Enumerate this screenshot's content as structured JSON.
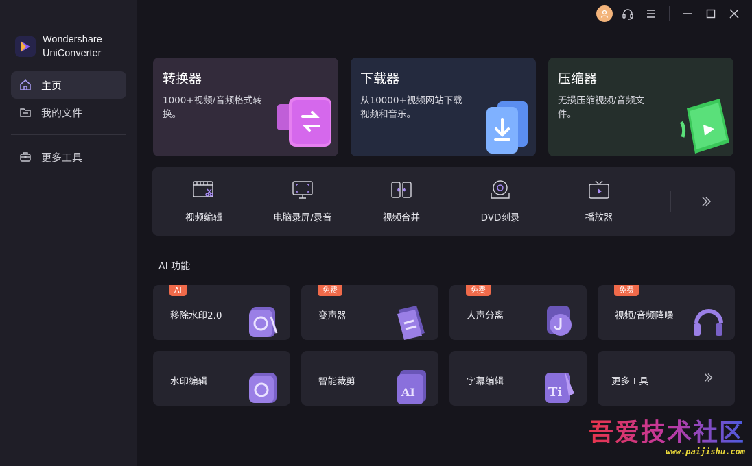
{
  "brand": {
    "line1": "Wondershare",
    "line2": "UniConverter"
  },
  "sidebar": {
    "items": [
      {
        "label": "主页",
        "icon": "home-icon"
      },
      {
        "label": "我的文件",
        "icon": "folder-icon"
      },
      {
        "label": "更多工具",
        "icon": "toolbox-icon"
      }
    ]
  },
  "feature_cards": [
    {
      "title": "转换器",
      "desc": "1000+视频/音频格式转换。"
    },
    {
      "title": "下载器",
      "desc": "从10000+视频网站下载视频和音乐。"
    },
    {
      "title": "压缩器",
      "desc": "无损压缩视频/音频文件。"
    }
  ],
  "tools": [
    {
      "label": "视频编辑",
      "icon": "video-edit-icon"
    },
    {
      "label": "电脑录屏/录音",
      "icon": "screen-record-icon"
    },
    {
      "label": "视频合并",
      "icon": "merge-icon"
    },
    {
      "label": "DVD刻录",
      "icon": "dvd-icon"
    },
    {
      "label": "播放器",
      "icon": "player-icon"
    }
  ],
  "ai_section": {
    "title": "AI 功能"
  },
  "ai_cards": [
    {
      "label": "移除水印2.0",
      "badge": "AI"
    },
    {
      "label": "变声器",
      "badge": "免费"
    },
    {
      "label": "人声分离",
      "badge": "免费"
    },
    {
      "label": "视频/音频降噪",
      "badge": "免费"
    },
    {
      "label": "水印编辑",
      "badge": ""
    },
    {
      "label": "智能裁剪",
      "badge": ""
    },
    {
      "label": "字幕编辑",
      "badge": ""
    },
    {
      "label": "更多工具",
      "badge": ""
    }
  ],
  "watermark": {
    "text": "吾爱技术社区",
    "url": "www.paijishu.com"
  },
  "colors": {
    "accent": "#7b5cf5",
    "badge": "#f06a4a"
  }
}
